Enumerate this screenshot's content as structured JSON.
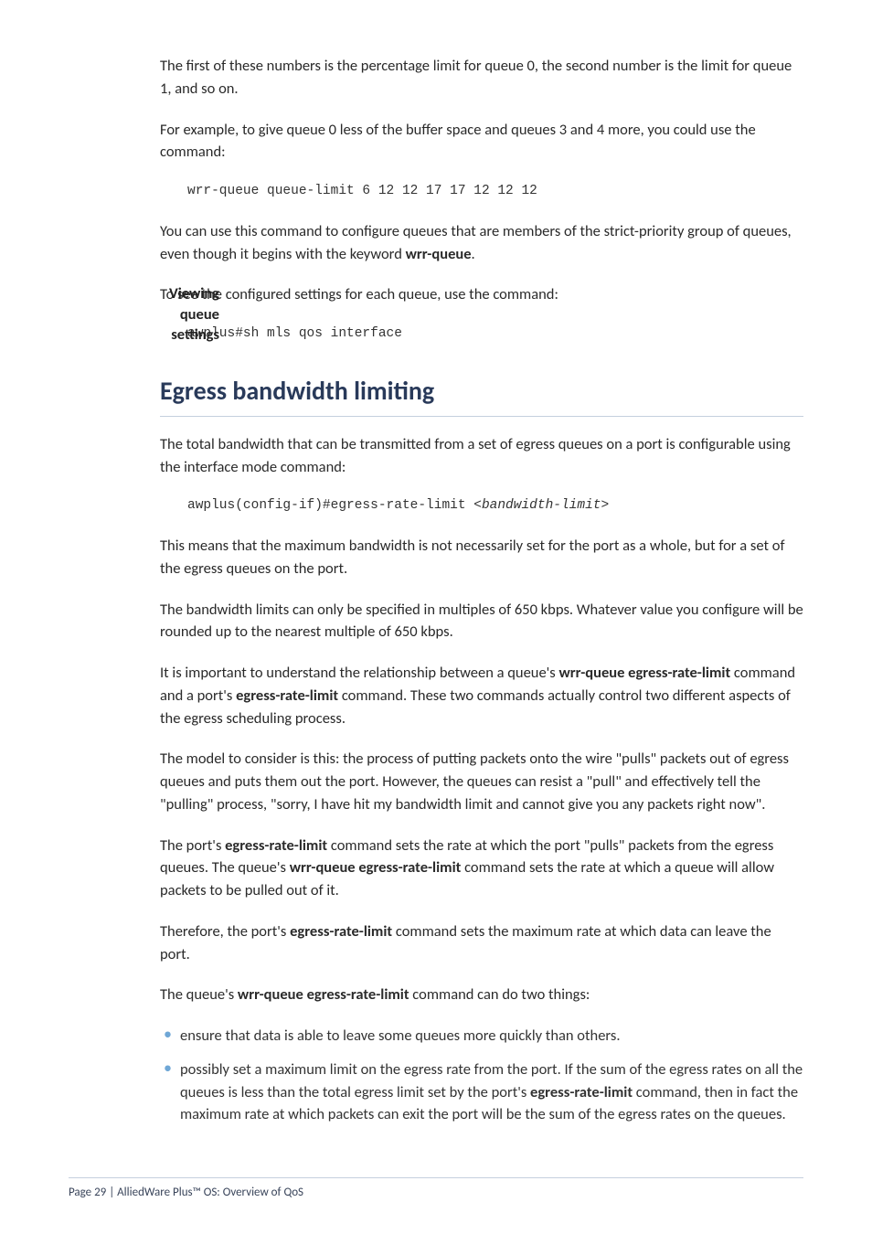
{
  "intro": {
    "p1": "The first of these numbers is the percentage limit for queue 0, the second number is the limit for queue 1, and so on.",
    "p2": "For example, to give queue 0 less of the buffer space and queues 3 and 4 more, you could use the command:",
    "code1": "wrr-queue queue-limit 6 12 12 17 17 12 12 12",
    "p3a": "You can use this command to configure queues that are members of the strict-priority group of queues, even though it begins with the keyword ",
    "p3b": "wrr-queue",
    "p3c": "."
  },
  "viewing": {
    "label1": "Viewing",
    "label2": "queue",
    "label3": "settings",
    "p1": "To see the configured settings for each queue, use the command:",
    "code1": "awplus#sh mls qos interface"
  },
  "heading": "Egress bandwidth limiting",
  "egress": {
    "p1": "The total bandwidth that can be transmitted from a set of egress queues on a port is configurable using the interface mode command:",
    "code1a": "awplus(config-if)#egress-rate-limit <",
    "code1b": "bandwidth-limit",
    "code1c": ">",
    "p2": "This means that the maximum bandwidth is not necessarily set for the port as a whole, but for a set of the egress queues on the port.",
    "p3": "The bandwidth limits can only be specified in multiples of 650 kbps. Whatever value you configure will be rounded up to the nearest multiple of 650 kbps.",
    "p4a": "It is important to understand the relationship between a queue's ",
    "p4b": "wrr-queue egress-rate-limit",
    "p4c": " command and a port's ",
    "p4d": "egress-rate-limit",
    "p4e": " command. These two commands actually control two different aspects of the egress scheduling process.",
    "p5": "The model to consider is this: the process of putting packets onto the wire \"pulls\" packets out of egress queues and puts them out the port. However, the queues can resist a \"pull\" and effectively tell the \"pulling\" process, \"sorry, I have hit my bandwidth limit and cannot give you any packets right now\".",
    "p6a": "The port's ",
    "p6b": "egress-rate-limit",
    "p6c": " command sets the rate at which the port \"pulls\" packets from the egress queues. The queue's ",
    "p6d": "wrr-queue egress-rate-limit",
    "p6e": " command sets the rate at which a queue will allow packets to be pulled out of it.",
    "p7a": "Therefore, the port's ",
    "p7b": "egress-rate-limit",
    "p7c": " command sets the maximum rate at which data can leave the port.",
    "p8a": "The queue's ",
    "p8b": "wrr-queue egress-rate-limit",
    "p8c": " command can do two things:",
    "b1": "ensure that data is able to leave some queues more quickly than others.",
    "b2a": "possibly set a maximum limit on the egress rate from the port. If the sum of the egress rates on all the queues is less than the total egress limit set by the port's ",
    "b2b": "egress-rate-limit",
    "b2c": " command, then in fact the maximum rate at which packets can exit the port will be the sum of the egress rates on the queues."
  },
  "footer": "Page 29 | AlliedWare Plus™ OS: Overview of QoS"
}
